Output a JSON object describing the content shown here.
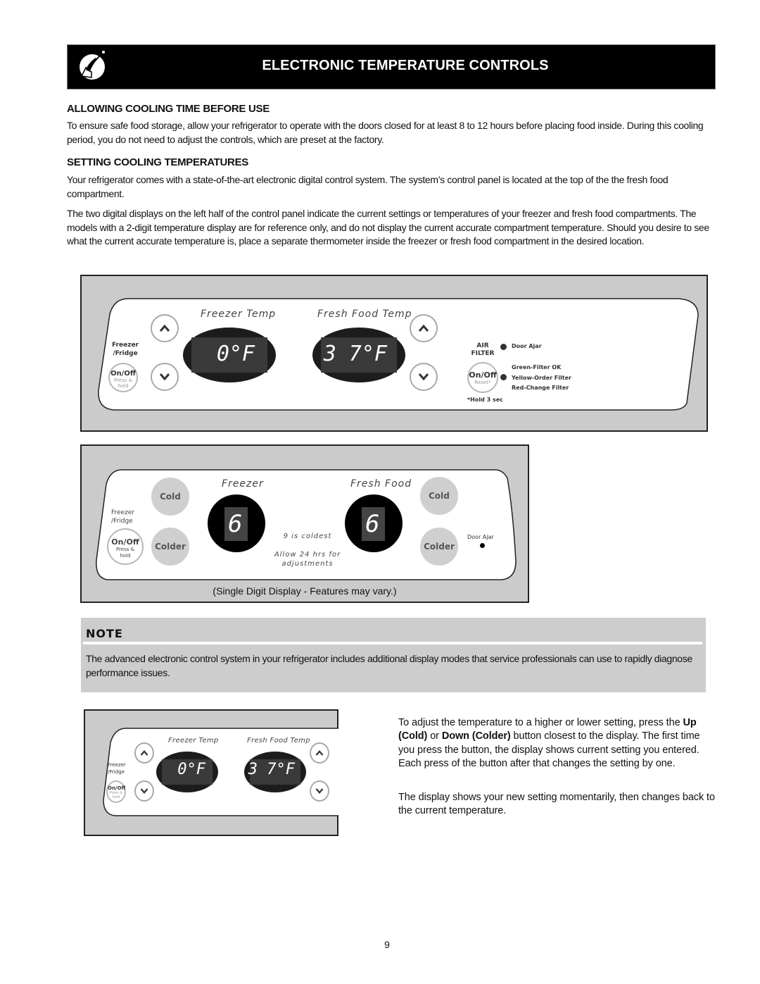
{
  "header": {
    "title": "ELECTRONIC TEMPERATURE CONTROLS",
    "icon": "hand-dial-icon"
  },
  "sections": [
    {
      "heading": "ALLOWING COOLING TIME BEFORE USE",
      "paragraphs": [
        "To ensure safe food storage, allow your refrigerator to operate with the doors closed for at least 8 to 12 hours before placing food inside. During this cooling period, you do not need to adjust the controls, which are preset at the factory."
      ]
    },
    {
      "heading": "SETTING COOLING TEMPERATURES",
      "paragraphs": [
        "Your refrigerator comes with a state-of-the-art electronic digital control system. The system’s control panel is located at the top of the the fresh food compartment.",
        "The two digital displays on the left half of the control panel indicate the current settings or temperatures of your freezer and fresh food compartments. The models with a 2-digit temperature display are for reference only, and do not display the current accurate compartment temperature.  Should you desire to see what the current accurate temperature is, place a separate thermometer inside the freezer or fresh food compartment in the desired location."
      ]
    }
  ],
  "panel1": {
    "freezer_fridge_label_1": "Freezer",
    "freezer_fridge_label_2": "/Fridge",
    "onoff_label": "On/Off",
    "onoff_sub_1": "Press &",
    "onoff_sub_2": "hold",
    "freezer_title": "Freezer Temp",
    "fresh_title": "Fresh Food Temp",
    "freezer_display": "0°F",
    "fresh_display": "3 7°F",
    "up_icon": "chevron-up-icon",
    "down_icon": "chevron-down-icon",
    "air_filter_1": "AIR",
    "air_filter_2": "FILTER",
    "door_ajar": "Door Ajar",
    "filter_onoff": "On/Off",
    "filter_reset": "Reset*",
    "filter_status": [
      "Green-Filter OK",
      "Yellow-Order Filter",
      "Red-Change Filter"
    ],
    "hold_note": "*Hold 3 sec"
  },
  "panel2": {
    "freezer_fridge_label_1": "Freezer",
    "freezer_fridge_label_2": "/Fridge",
    "onoff_label": "On/Off",
    "onoff_sub_1": "Press &",
    "onoff_sub_2": "hold",
    "cold_label": "Cold",
    "colder_label": "Colder",
    "freezer_title": "Freezer",
    "fresh_title": "Fresh Food",
    "freezer_digit": "6",
    "fresh_digit": "6",
    "coldest_note": "9 is coldest",
    "allow_note_1": "Allow 24 hrs for",
    "allow_note_2": "adjustments",
    "door_ajar": "Door Ajar",
    "caption": "(Single Digit Display - Features may vary.)"
  },
  "note": {
    "title": "NOTE",
    "text": "The advanced electronic control system in your refrigerator includes additional display modes that service professionals can use to rapidly diagnose performance issues."
  },
  "panel3": {
    "freezer_fridge_label_1": "Freezer",
    "freezer_fridge_label_2": "/Fridge",
    "onoff_label": "On/Off",
    "onoff_sub_1": "Press &",
    "onoff_sub_2": "hold",
    "freezer_title": "Freezer Temp",
    "fresh_title": "Fresh Food Temp",
    "freezer_display": "0°F",
    "fresh_display": "3 7°F"
  },
  "adjust": {
    "p1_a": "To adjust the temperature to a higher or lower setting, press the ",
    "p1_bold1": "Up (Cold)",
    "p1_b": " or ",
    "p1_bold2": "Down (Colder)",
    "p1_c": " button closest to the display. The first time you press the button, the display shows current setting you entered. Each press of the button after that changes the setting by one.",
    "p2": "The display shows your new setting momentarily, then changes back to the current temperature."
  },
  "page_number": "9"
}
